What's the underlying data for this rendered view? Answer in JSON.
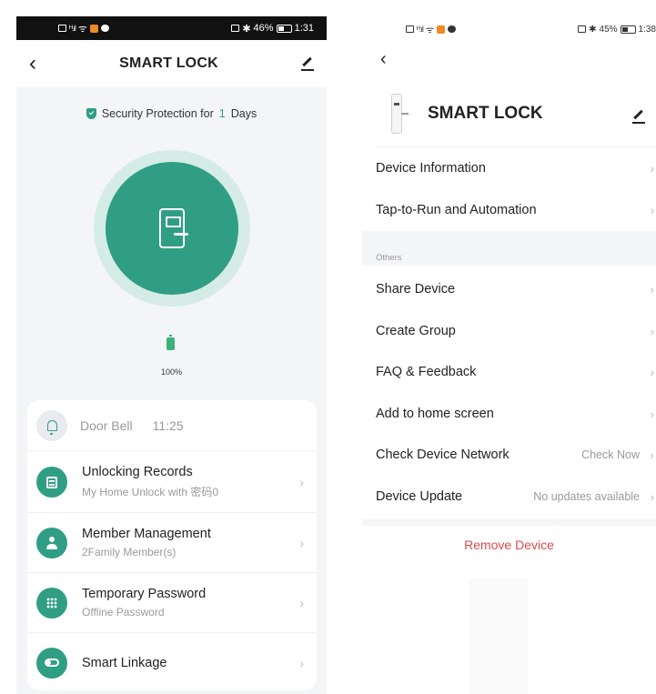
{
  "left": {
    "status_bar": {
      "signal": "ᴴ.ıl",
      "battery": "46%",
      "time": "1:31"
    },
    "header": {
      "title": "SMART LOCK",
      "back_icon": "back-chevron",
      "edit_icon": "pencil-icon"
    },
    "security": {
      "prefix": "Security Protection for",
      "days": "1",
      "suffix": "Days"
    },
    "battery_percent": "100%",
    "door_bell": {
      "label": "Door Bell",
      "time": "11:25"
    },
    "menu": [
      {
        "title": "Unlocking Records",
        "subtitle": "My Home Unlock with 密码0",
        "icon": "records-icon"
      },
      {
        "title": "Member Management",
        "subtitle": "2Family Member(s)",
        "icon": "member-icon"
      },
      {
        "title": "Temporary Password",
        "subtitle": "Offline Password",
        "icon": "keypad-icon"
      },
      {
        "title": "Smart Linkage",
        "subtitle": "",
        "icon": "toggle-icon"
      }
    ],
    "colors": {
      "accent": "#2f9e84",
      "ring": "#d4ece5",
      "background": "#f4f5f7"
    }
  },
  "right": {
    "status_bar": {
      "signal": "ᴴ.ıl",
      "battery": "45%",
      "time": "1:38"
    },
    "header": {
      "title": "SMART LOCK"
    },
    "rows_top": [
      {
        "label": "Device Information"
      },
      {
        "label": "Tap-to-Run and Automation"
      }
    ],
    "section_label": "Others",
    "rows_others": [
      {
        "label": "Share Device",
        "value": ""
      },
      {
        "label": "Create Group",
        "value": ""
      },
      {
        "label": "FAQ & Feedback",
        "value": ""
      },
      {
        "label": "Add to home screen",
        "value": ""
      },
      {
        "label": "Check Device Network",
        "value": "Check Now"
      },
      {
        "label": "Device Update",
        "value": "No updates available"
      }
    ],
    "remove_label": "Remove Device",
    "colors": {
      "danger": "#e04a4a"
    }
  },
  "glyphs": {
    "back": "‹",
    "chevron": "›"
  }
}
